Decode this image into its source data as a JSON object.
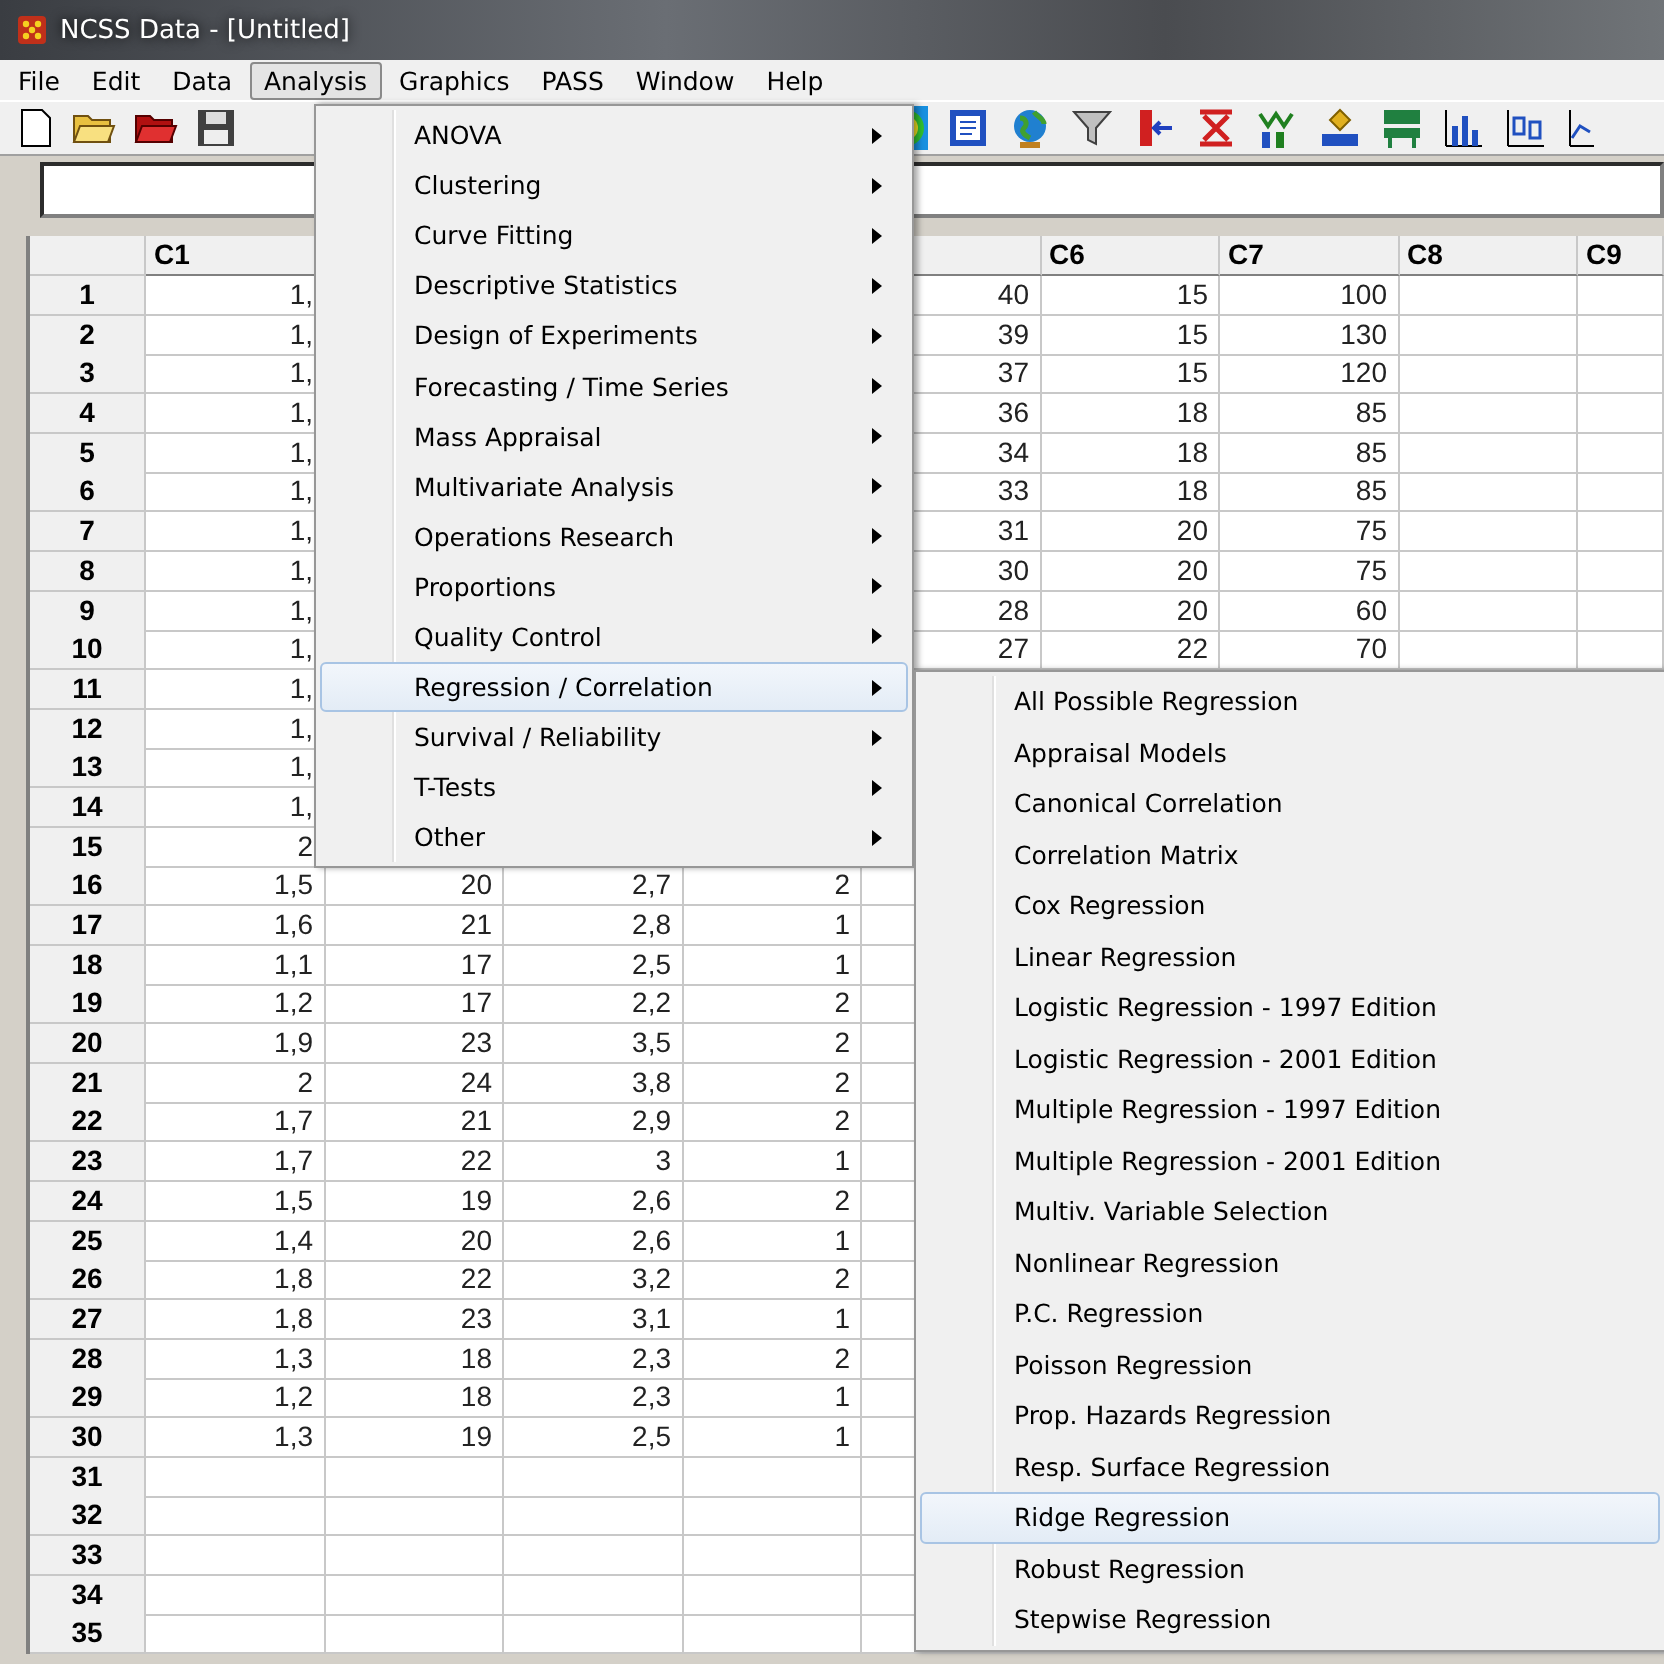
{
  "window": {
    "title": "NCSS Data - [Untitled]"
  },
  "menu_bar": [
    {
      "label": "File",
      "selected": false
    },
    {
      "label": "Edit",
      "selected": false
    },
    {
      "label": "Data",
      "selected": false
    },
    {
      "label": "Analysis",
      "selected": true
    },
    {
      "label": "Graphics",
      "selected": false
    },
    {
      "label": "PASS",
      "selected": false
    },
    {
      "label": "Window",
      "selected": false
    },
    {
      "label": "Help",
      "selected": false
    }
  ],
  "table": {
    "columns": [
      "C1",
      null,
      null,
      null,
      null,
      "C6",
      "C7",
      "C8",
      "C9"
    ],
    "rows": [
      {
        "label": "1",
        "cells": [
          "1,",
          null,
          null,
          null,
          "40",
          "15",
          "100",
          null,
          null
        ]
      },
      {
        "label": "2",
        "cells": [
          "1,",
          null,
          null,
          null,
          "39",
          "15",
          "130",
          null,
          null
        ]
      },
      {
        "label": "3",
        "cells": [
          "1,",
          null,
          null,
          null,
          "37",
          "15",
          "120",
          null,
          null
        ]
      },
      {
        "label": "4",
        "cells": [
          "1,",
          null,
          null,
          null,
          "36",
          "18",
          "85",
          null,
          null
        ]
      },
      {
        "label": "5",
        "cells": [
          "1,",
          null,
          null,
          null,
          "34",
          "18",
          "85",
          null,
          null
        ]
      },
      {
        "label": "6",
        "cells": [
          "1,",
          null,
          null,
          null,
          "33",
          "18",
          "85",
          null,
          null
        ]
      },
      {
        "label": "7",
        "cells": [
          "1,",
          null,
          null,
          null,
          "31",
          "20",
          "75",
          null,
          null
        ]
      },
      {
        "label": "8",
        "cells": [
          "1,",
          null,
          null,
          null,
          "30",
          "20",
          "75",
          null,
          null
        ]
      },
      {
        "label": "9",
        "cells": [
          "1,",
          null,
          null,
          null,
          "28",
          "20",
          "60",
          null,
          null
        ]
      },
      {
        "label": "10",
        "cells": [
          "1,",
          null,
          null,
          null,
          "27",
          "22",
          "70",
          null,
          null
        ]
      },
      {
        "label": "11",
        "cells": [
          "1,",
          null,
          null,
          null,
          null,
          null,
          null,
          null,
          null
        ]
      },
      {
        "label": "12",
        "cells": [
          "1,",
          null,
          null,
          null,
          null,
          null,
          null,
          null,
          null
        ]
      },
      {
        "label": "13",
        "cells": [
          "1,",
          null,
          null,
          null,
          null,
          null,
          null,
          null,
          null
        ]
      },
      {
        "label": "14",
        "cells": [
          "1,",
          null,
          null,
          null,
          null,
          null,
          null,
          null,
          null
        ]
      },
      {
        "label": "15",
        "cells": [
          "2",
          null,
          null,
          null,
          null,
          null,
          null,
          null,
          null
        ]
      },
      {
        "label": "16",
        "cells": [
          "1,5",
          "20",
          "2,7",
          "2",
          null,
          null,
          null,
          null,
          null
        ]
      },
      {
        "label": "17",
        "cells": [
          "1,6",
          "21",
          "2,8",
          "1",
          null,
          null,
          null,
          null,
          null
        ]
      },
      {
        "label": "18",
        "cells": [
          "1,1",
          "17",
          "2,5",
          "1",
          null,
          null,
          null,
          null,
          null
        ]
      },
      {
        "label": "19",
        "cells": [
          "1,2",
          "17",
          "2,2",
          "2",
          null,
          null,
          null,
          null,
          null
        ]
      },
      {
        "label": "20",
        "cells": [
          "1,9",
          "23",
          "3,5",
          "2",
          null,
          null,
          null,
          null,
          null
        ]
      },
      {
        "label": "21",
        "cells": [
          "2",
          "24",
          "3,8",
          "2",
          null,
          null,
          null,
          null,
          null
        ]
      },
      {
        "label": "22",
        "cells": [
          "1,7",
          "21",
          "2,9",
          "2",
          null,
          null,
          null,
          null,
          null
        ]
      },
      {
        "label": "23",
        "cells": [
          "1,7",
          "22",
          "3",
          "1",
          null,
          null,
          null,
          null,
          null
        ]
      },
      {
        "label": "24",
        "cells": [
          "1,5",
          "19",
          "2,6",
          "2",
          null,
          null,
          null,
          null,
          null
        ]
      },
      {
        "label": "25",
        "cells": [
          "1,4",
          "20",
          "2,6",
          "1",
          null,
          null,
          null,
          null,
          null
        ]
      },
      {
        "label": "26",
        "cells": [
          "1,8",
          "22",
          "3,2",
          "2",
          null,
          null,
          null,
          null,
          null
        ]
      },
      {
        "label": "27",
        "cells": [
          "1,8",
          "23",
          "3,1",
          "1",
          null,
          null,
          null,
          null,
          null
        ]
      },
      {
        "label": "28",
        "cells": [
          "1,3",
          "18",
          "2,3",
          "2",
          null,
          null,
          null,
          null,
          null
        ]
      },
      {
        "label": "29",
        "cells": [
          "1,2",
          "18",
          "2,3",
          "1",
          null,
          null,
          null,
          null,
          null
        ]
      },
      {
        "label": "30",
        "cells": [
          "1,3",
          "19",
          "2,5",
          "1",
          null,
          null,
          null,
          null,
          null
        ]
      },
      {
        "label": "31",
        "cells": [
          null,
          null,
          null,
          null,
          null,
          null,
          null,
          null,
          null
        ]
      },
      {
        "label": "32",
        "cells": [
          null,
          null,
          null,
          null,
          null,
          null,
          null,
          null,
          null
        ]
      },
      {
        "label": "33",
        "cells": [
          null,
          null,
          null,
          null,
          null,
          null,
          null,
          null,
          null
        ]
      },
      {
        "label": "34",
        "cells": [
          null,
          null,
          null,
          null,
          null,
          null,
          null,
          null,
          null
        ]
      },
      {
        "label": "35",
        "cells": [
          null,
          null,
          null,
          null,
          null,
          null,
          null,
          null,
          null
        ]
      }
    ]
  },
  "analysis_menu": [
    {
      "label": "ANOVA",
      "has_submenu": true,
      "selected": false
    },
    {
      "label": "Clustering",
      "has_submenu": true,
      "selected": false
    },
    {
      "label": "Curve Fitting",
      "has_submenu": true,
      "selected": false
    },
    {
      "label": "Descriptive Statistics",
      "has_submenu": true,
      "selected": false
    },
    {
      "label": "Design of Experiments",
      "has_submenu": true,
      "selected": false
    },
    {
      "label": "Forecasting / Time Series",
      "has_submenu": true,
      "selected": false
    },
    {
      "label": "Mass Appraisal",
      "has_submenu": true,
      "selected": false
    },
    {
      "label": "Multivariate Analysis",
      "has_submenu": true,
      "selected": false
    },
    {
      "label": "Operations Research",
      "has_submenu": true,
      "selected": false
    },
    {
      "label": "Proportions",
      "has_submenu": true,
      "selected": false
    },
    {
      "label": "Quality Control",
      "has_submenu": true,
      "selected": false
    },
    {
      "label": "Regression / Correlation",
      "has_submenu": true,
      "selected": true
    },
    {
      "label": "Survival / Reliability",
      "has_submenu": true,
      "selected": false
    },
    {
      "label": "T-Tests",
      "has_submenu": true,
      "selected": false
    },
    {
      "label": "Other",
      "has_submenu": true,
      "selected": false
    }
  ],
  "regression_submenu": [
    {
      "label": "All Possible Regression",
      "selected": false
    },
    {
      "label": "Appraisal Models",
      "selected": false
    },
    {
      "label": "Canonical Correlation",
      "selected": false
    },
    {
      "label": "Correlation Matrix",
      "selected": false
    },
    {
      "label": "Cox Regression",
      "selected": false
    },
    {
      "label": "Linear Regression",
      "selected": false
    },
    {
      "label": "Logistic Regression - 1997 Edition",
      "selected": false
    },
    {
      "label": "Logistic Regression - 2001 Edition",
      "selected": false
    },
    {
      "label": "Multiple Regression - 1997 Edition",
      "selected": false
    },
    {
      "label": "Multiple Regression - 2001 Edition",
      "selected": false
    },
    {
      "label": "Multiv. Variable Selection",
      "selected": false
    },
    {
      "label": "Nonlinear Regression",
      "selected": false
    },
    {
      "label": "P.C. Regression",
      "selected": false
    },
    {
      "label": "Poisson Regression",
      "selected": false
    },
    {
      "label": "Prop. Hazards Regression",
      "selected": false
    },
    {
      "label": "Resp. Surface Regression",
      "selected": false
    },
    {
      "label": "Ridge Regression",
      "selected": true
    },
    {
      "label": "Robust Regression",
      "selected": false
    },
    {
      "label": "Stepwise Regression",
      "selected": false
    }
  ]
}
